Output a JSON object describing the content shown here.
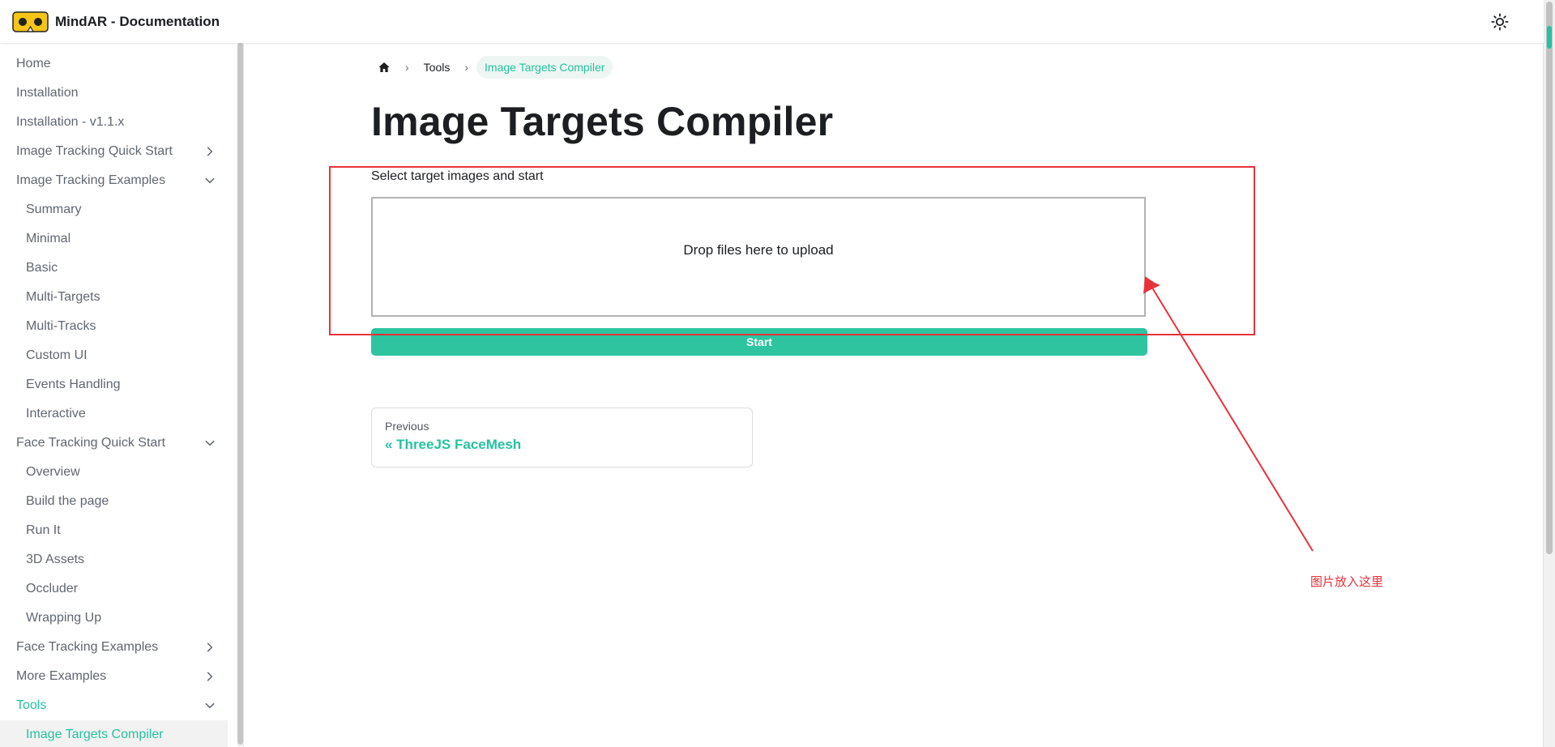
{
  "brand": {
    "title": "MindAR - Documentation"
  },
  "sidebar": {
    "items": [
      {
        "label": "Home",
        "level": 0
      },
      {
        "label": "Installation",
        "level": 0
      },
      {
        "label": "Installation - v1.1.x",
        "level": 0
      },
      {
        "label": "Image Tracking Quick Start",
        "level": 0,
        "chevron": "right"
      },
      {
        "label": "Image Tracking Examples",
        "level": 0,
        "chevron": "down"
      },
      {
        "label": "Summary",
        "level": 1
      },
      {
        "label": "Minimal",
        "level": 1
      },
      {
        "label": "Basic",
        "level": 1
      },
      {
        "label": "Multi-Targets",
        "level": 1
      },
      {
        "label": "Multi-Tracks",
        "level": 1
      },
      {
        "label": "Custom UI",
        "level": 1
      },
      {
        "label": "Events Handling",
        "level": 1
      },
      {
        "label": "Interactive",
        "level": 1
      },
      {
        "label": "Face Tracking Quick Start",
        "level": 0,
        "chevron": "down"
      },
      {
        "label": "Overview",
        "level": 1
      },
      {
        "label": "Build the page",
        "level": 1
      },
      {
        "label": "Run It",
        "level": 1
      },
      {
        "label": "3D Assets",
        "level": 1
      },
      {
        "label": "Occluder",
        "level": 1
      },
      {
        "label": "Wrapping Up",
        "level": 1
      },
      {
        "label": "Face Tracking Examples",
        "level": 0,
        "chevron": "right"
      },
      {
        "label": "More Examples",
        "level": 0,
        "chevron": "right"
      },
      {
        "label": "Tools",
        "level": 0,
        "chevron": "down",
        "active": true
      },
      {
        "label": "Image Targets Compiler",
        "level": 1,
        "current": true
      }
    ]
  },
  "breadcrumbs": {
    "home_icon": "home-icon",
    "tools": "Tools",
    "current": "Image Targets Compiler",
    "separator": "›"
  },
  "main": {
    "title": "Image Targets Compiler",
    "intro": "Select target images and start",
    "dropzone_text": "Drop files here to upload",
    "start_label": "Start"
  },
  "pagination": {
    "sub": "Previous",
    "label": "« ThreeJS FaceMesh"
  },
  "annotation": {
    "text": "图片放入这里"
  },
  "colors": {
    "accent": "#25c2a0",
    "annotation": "#e8323a",
    "logo_yellow": "#f5c518"
  }
}
